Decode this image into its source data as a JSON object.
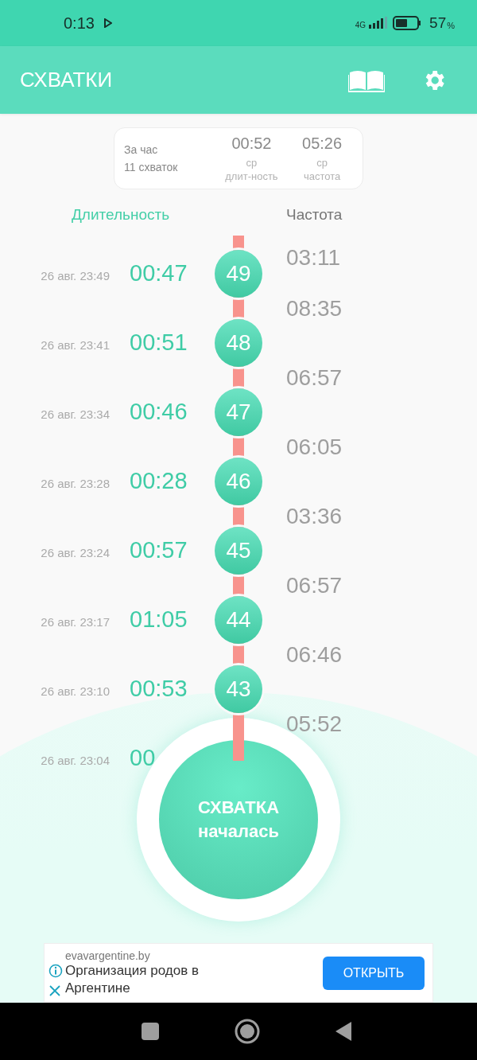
{
  "status_bar": {
    "time": "0:13",
    "network": "4G",
    "battery": "57",
    "battery_unit": "%"
  },
  "app_bar": {
    "title": "СХВАТКИ"
  },
  "summary": {
    "period": "За час",
    "count": "11 схваток",
    "stats": [
      {
        "value": "00:52",
        "lines": [
          "ср",
          "длит-ность"
        ]
      },
      {
        "value": "05:26",
        "lines": [
          "ср",
          "частота"
        ]
      }
    ]
  },
  "columns": [
    {
      "label": "Длительность",
      "selected": true
    },
    {
      "label": "Частота",
      "selected": false
    }
  ],
  "contractions": [
    {
      "number": "49",
      "date": "26 авг. 23:49",
      "duration": "00:47"
    },
    {
      "number": "48",
      "date": "26 авг. 23:41",
      "duration": "00:51"
    },
    {
      "number": "47",
      "date": "26 авг. 23:34",
      "duration": "00:46"
    },
    {
      "number": "46",
      "date": "26 авг. 23:28",
      "duration": "00:28"
    },
    {
      "number": "45",
      "date": "26 авг. 23:24",
      "duration": "00:57"
    },
    {
      "number": "44",
      "date": "26 авг. 23:17",
      "duration": "01:05"
    },
    {
      "number": "43",
      "date": "26 авг. 23:10",
      "duration": "00:53"
    },
    {
      "date": "26 авг. 23:04",
      "duration": "00"
    }
  ],
  "intervals": [
    "03:11",
    "08:35",
    "06:57",
    "06:05",
    "03:36",
    "06:57",
    "06:46",
    "05:52"
  ],
  "start_button": {
    "line_1": "СХВАТКА",
    "line_2": "началась"
  },
  "ad": {
    "domain": "evavargentine.by",
    "title": "Организация родов в Аргентине",
    "button": "ОТКРЫТЬ"
  }
}
